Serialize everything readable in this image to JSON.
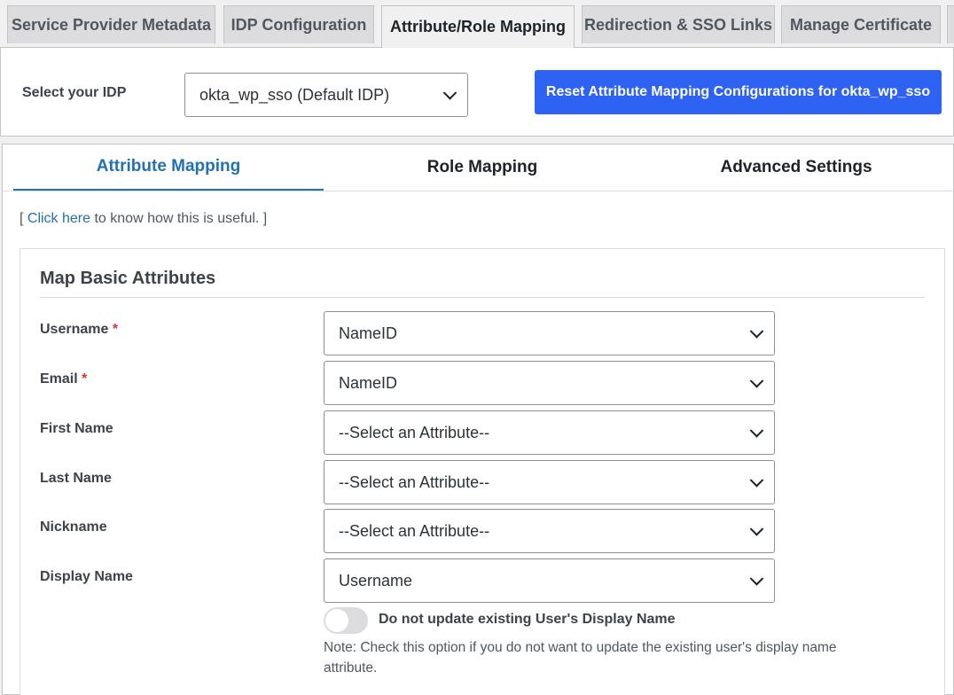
{
  "top_tabs": [
    {
      "label": "Service Provider Metadata"
    },
    {
      "label": "IDP Configuration"
    },
    {
      "label": "Attribute/Role Mapping"
    },
    {
      "label": "Redirection & SSO Links"
    },
    {
      "label": "Manage Certificate"
    }
  ],
  "idp": {
    "label": "Select your IDP",
    "selected": "okta_wp_sso (Default IDP)",
    "reset_button": "Reset Attribute Mapping Configurations for okta_wp_sso"
  },
  "sub_tabs": [
    {
      "label": "Attribute Mapping"
    },
    {
      "label": "Role Mapping"
    },
    {
      "label": "Advanced Settings"
    }
  ],
  "help": {
    "prefix": "[ ",
    "link": "Click here",
    "suffix": " to know how this is useful. ]"
  },
  "card": {
    "title": "Map Basic Attributes",
    "rows": [
      {
        "label": "Username",
        "required": "*",
        "value": "NameID"
      },
      {
        "label": "Email",
        "required": "*",
        "value": "NameID"
      },
      {
        "label": "First Name",
        "value": "--Select an Attribute--"
      },
      {
        "label": "Last Name",
        "value": "--Select an Attribute--"
      },
      {
        "label": "Nickname",
        "value": "--Select an Attribute--"
      },
      {
        "label": "Display Name",
        "value": "Username"
      }
    ],
    "toggle_label": "Do not update existing User's Display Name",
    "toggle_on": false,
    "note": "Note: Check this option if you do not want to update the existing user's display name attribute."
  }
}
